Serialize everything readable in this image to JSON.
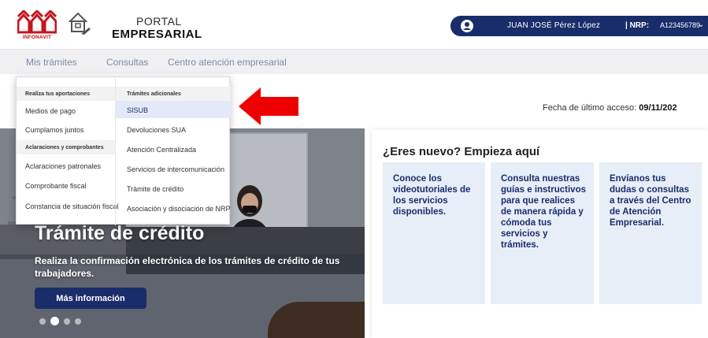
{
  "header": {
    "brand_logo_text": "INFONAVIT",
    "portal_line1": "PORTAL",
    "portal_line2": "EMPRESARIAL",
    "user_name": "JUAN JOSÉ Pérez López",
    "nrp_label": "| NRP:",
    "nrp_value": "A123456789",
    "colors": {
      "brand_red": "#c4161c",
      "navy": "#1a2d6b"
    }
  },
  "nav": {
    "items": [
      "Mis trámites",
      "Consultas",
      "Centro atención empresarial"
    ]
  },
  "dropdown": {
    "left_col": {
      "section1_header": "Realiza tus aportaciones",
      "section1_items": [
        "Medios de pago",
        "Cumplamos juntos"
      ],
      "section2_header": "Aclaraciones y comprobantes",
      "section2_items": [
        "Aclaraciones patronales",
        "Comprobante fiscal",
        "Constancia de situación fiscal"
      ]
    },
    "right_col": {
      "header": "Trámites adicionales",
      "items": [
        "SISUB",
        "Devoluciones SUA",
        "Atención Centralizada",
        "Servicios de intercomunicación",
        "Trámite de crédito",
        "Asociación y disociación de NRP"
      ],
      "active_item": "SISUB"
    }
  },
  "last_access": {
    "label": "Fecha de último acceso:",
    "value": "09/11/202"
  },
  "hero": {
    "title": "Trámite de crédito",
    "subtitle": "Realiza la confirmación electrónica de los trámites de crédito de tus trabajadores.",
    "button_label": "Más información",
    "carousel_active_index": 1,
    "carousel_count": 4
  },
  "start_panel": {
    "title": "¿Eres nuevo? Empieza aquí",
    "cards": [
      "Conoce los videotutoriales de los servicios disponibles.",
      "Consulta nuestras guías e instructivos para que realices de manera rápida y cómoda tus servicios y trámites.",
      "Envíanos tus dudas o consultas a través del Centro de Atención Empresarial."
    ]
  },
  "icons": {
    "logo": "infonavit-houses-icon",
    "portal": "portal-empresarial-icon",
    "user": "user-icon",
    "dropdown": "chevron-down-icon",
    "annotation": "red-arrow-icon"
  }
}
